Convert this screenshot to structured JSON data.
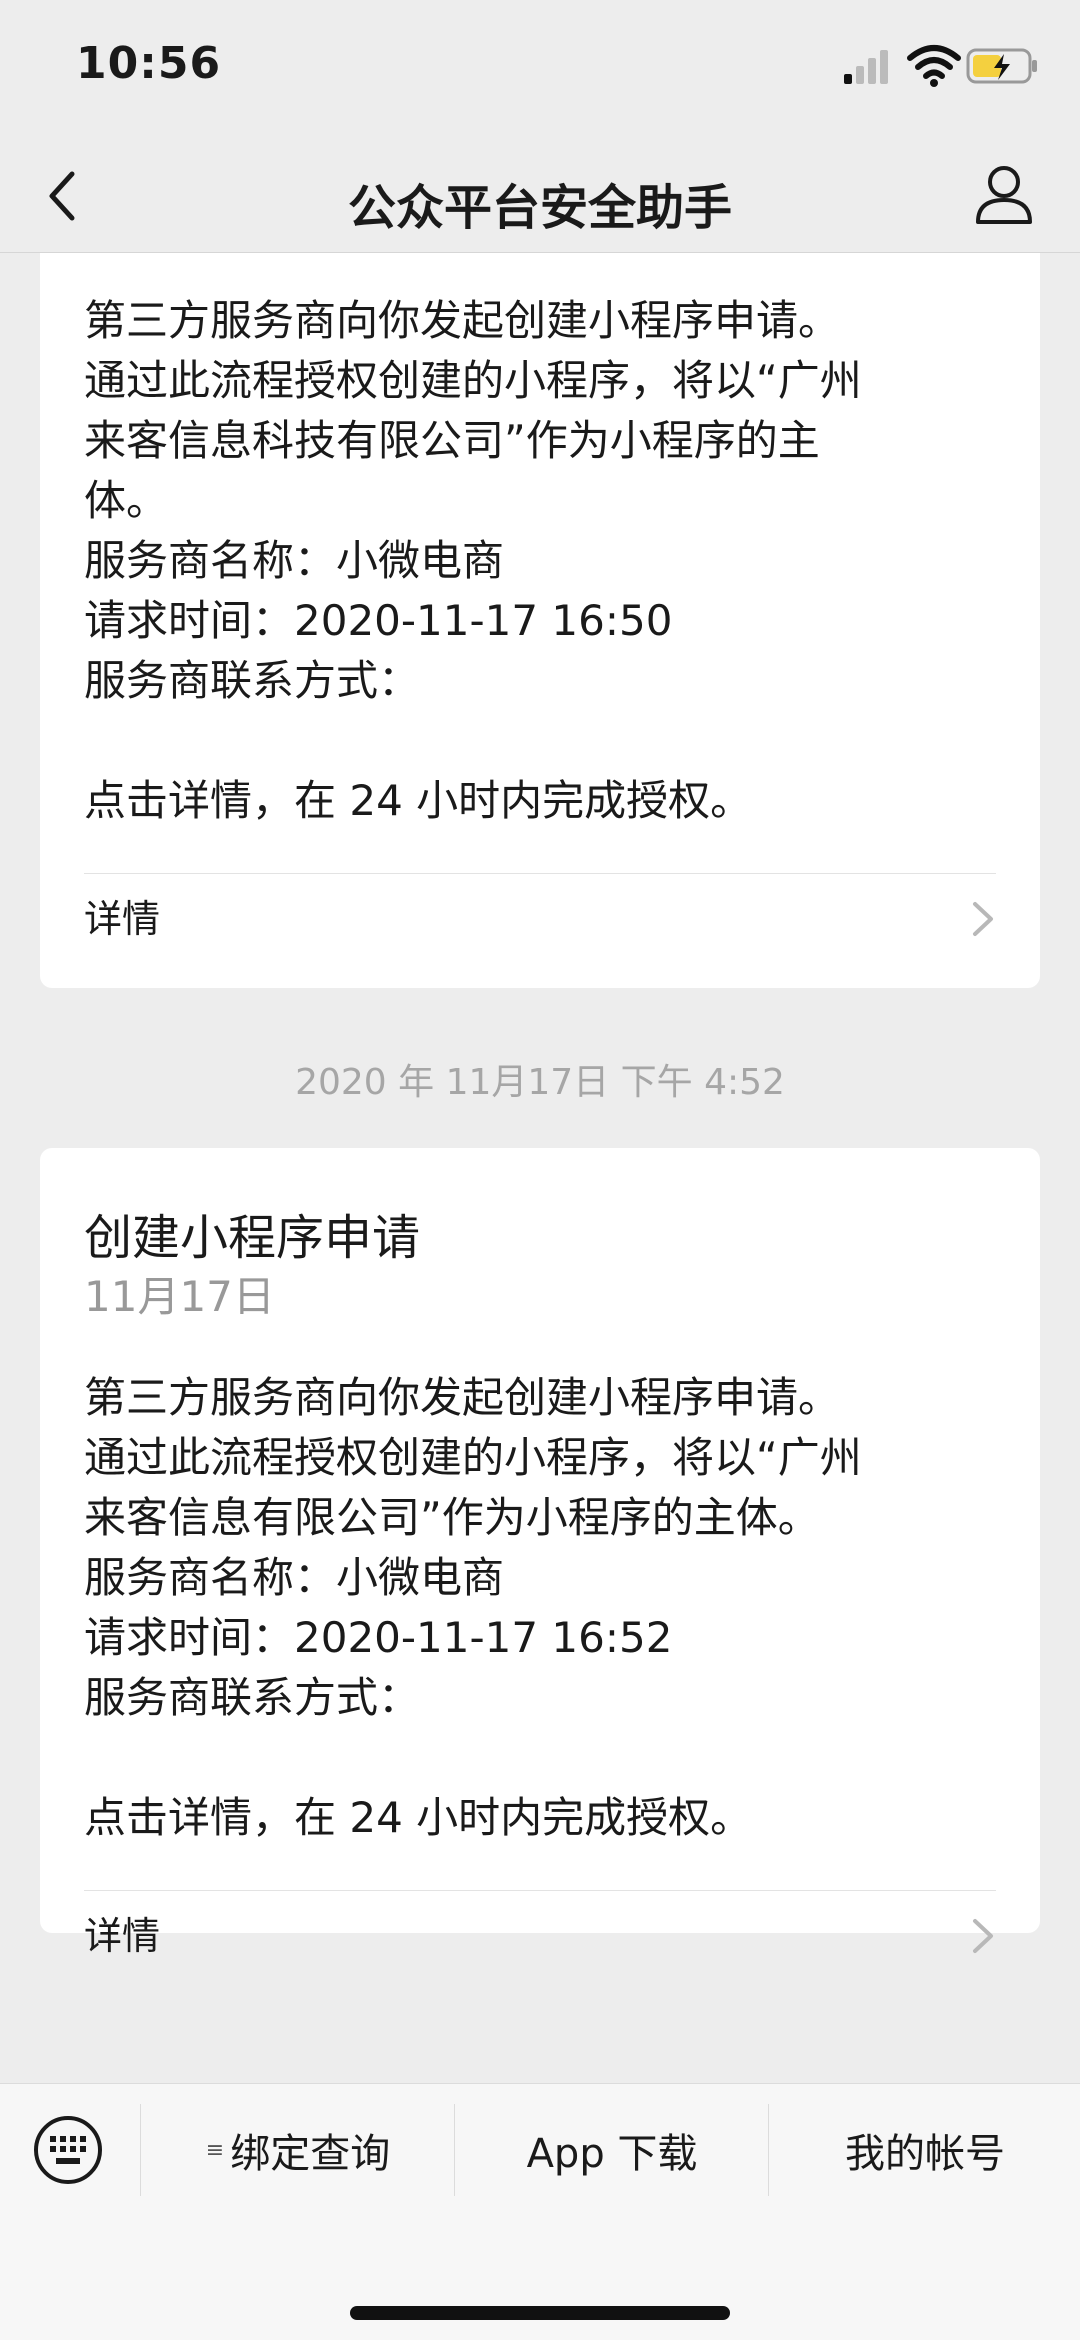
{
  "status": {
    "time": "10:56"
  },
  "nav": {
    "title": "公众平台安全助手"
  },
  "messages": [
    {
      "lines": [
        "第三方服务商向你发起创建小程序申请。",
        "通过此流程授权创建的小程序，将以“广州",
        "来客信息科技有限公司”作为小程序的主",
        "体。",
        "服务商名称：小微电商",
        "请求时间：2020-11-17 16:50",
        "服务商联系方式："
      ],
      "note": "点击详情，在 24 小时内完成授权。",
      "detail_label": "详情"
    },
    {
      "title": "创建小程序申请",
      "date": "11月17日",
      "lines": [
        "第三方服务商向你发起创建小程序申请。",
        "通过此流程授权创建的小程序，将以“广州",
        "来客信息有限公司”作为小程序的主体。",
        "服务商名称：小微电商",
        "请求时间：2020-11-17 16:52",
        "服务商联系方式："
      ],
      "note": "点击详情，在 24 小时内完成授权。",
      "detail_label": "详情"
    }
  ],
  "timestamp": "2020 年 11月17日 下午 4:52",
  "toolbar": {
    "items": [
      "绑定查询",
      "App 下载",
      "我的帐号"
    ]
  },
  "icons": {
    "back": "chevron-left-icon",
    "profile": "person-icon",
    "keyboard": "keyboard-icon",
    "menu": "menu-icon",
    "chevron": "chevron-right-icon",
    "signal": "signal-icon",
    "wifi": "wifi-icon",
    "battery": "battery-charging-icon"
  },
  "colors": {
    "background": "#ededed",
    "card": "#ffffff",
    "muted": "#999999",
    "battery": "#f4d03f"
  }
}
